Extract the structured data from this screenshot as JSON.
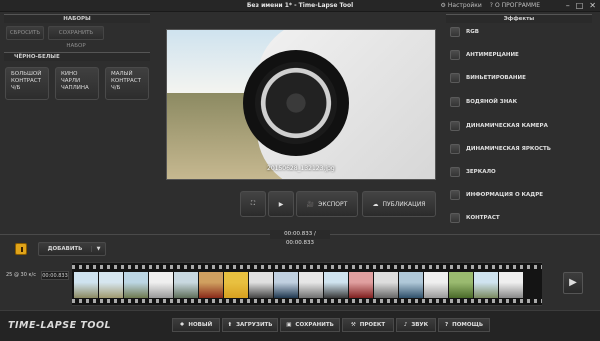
{
  "window": {
    "title": "Без имени 1* - Time-Lapse Tool",
    "settings_label": "Настройки",
    "about_label": "О ПРОГРАММЕ"
  },
  "presets": {
    "title": "НАБОРЫ",
    "reset_label": "СБРОСИТЬ",
    "save_label": "СОХРАНИТЬ НАБОР"
  },
  "bw": {
    "title": "ЧЁРНО-БЕЛЫЕ",
    "items": [
      "БОЛЬШОЙ КОНТРАСТ Ч/Б",
      "КИНО ЧАРЛИ ЧАПЛИНА",
      "МАЛЫЙ КОНТРАСТ Ч/Б"
    ]
  },
  "preview": {
    "caption": "20150628_132123.jpg"
  },
  "controls": {
    "export_label": "ЭКСПОРТ",
    "publish_label": "ПУБЛИКАЦИЯ"
  },
  "effects": {
    "title": "Эффекты",
    "items": [
      "RGB",
      "АНТИМЕРЦАНИЕ",
      "ВИНЬЕТИРОВАНИЕ",
      "ВОДЯНОЙ ЗНАК",
      "ДИНАМИЧЕСКАЯ КАМЕРА",
      "ДИНАМИЧЕСКАЯ ЯРКОСТЬ",
      "ЗЕРКАЛО",
      "ИНФОРМАЦИЯ О КАДРЕ",
      "КОНТРАСТ"
    ]
  },
  "timeline": {
    "time": "00:00.833 / 00:00.833",
    "add_label": "ДОБАВИТЬ",
    "fps_label": "25 @ 30 к/с",
    "duration": "00:00.833"
  },
  "bottom": {
    "logo": "TIME-LAPSE TOOL",
    "buttons": [
      "НОВЫЙ",
      "ЗАГРУЗИТЬ",
      "СОХРАНИТЬ",
      "ПРОЕКТ",
      "ЗВУК",
      "ПОМОЩЬ"
    ]
  }
}
